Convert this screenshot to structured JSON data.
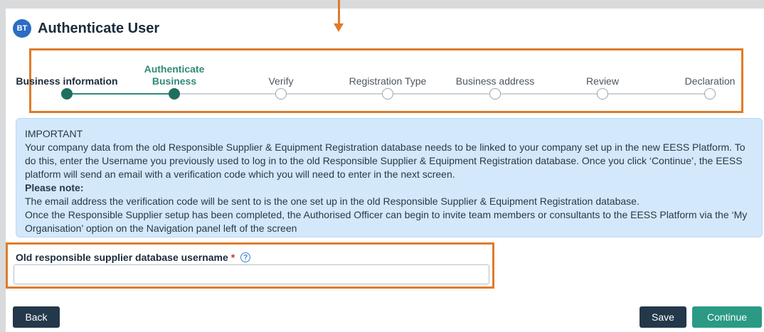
{
  "header": {
    "avatar_initials": "BT",
    "title": "Authenticate User"
  },
  "stepper": {
    "steps": [
      {
        "label": "Business information",
        "state": "done"
      },
      {
        "label": "Authenticate Business",
        "state": "current"
      },
      {
        "label": "Verify",
        "state": "pending"
      },
      {
        "label": "Registration Type",
        "state": "pending"
      },
      {
        "label": "Business address",
        "state": "pending"
      },
      {
        "label": "Review",
        "state": "pending"
      },
      {
        "label": "Declaration",
        "state": "pending"
      }
    ]
  },
  "notice": {
    "heading": "IMPORTANT",
    "paragraph": "Your company data from the old Responsible Supplier & Equipment Registration database needs to be linked to your company set up in the new EESS Platform. To do this, enter the Username you previously used to log in to the old Responsible Supplier & Equipment Registration database. Once you click ‘Continue’, the EESS platform will send an email with a verification code which you will need to enter in the next screen.",
    "note_heading": "Please note:",
    "note_line1": "The email address the verification code will be sent to is the one set up in the old Responsible Supplier & Equipment Registration database.",
    "note_line2": "Once the Responsible Supplier setup has been completed, the Authorised Officer can begin to invite team members or consultants to the EESS Platform via the ‘My Organisation’ option on the Navigation panel left of the screen"
  },
  "form": {
    "username_label": "Old responsible supplier database username",
    "required_mark": "*",
    "help_glyph": "?",
    "username_value": ""
  },
  "actions": {
    "back_label": "Back",
    "save_label": "Save",
    "continue_label": "Continue"
  },
  "colors": {
    "accent": "#2a9a85",
    "dark_button": "#24384b",
    "callout": "#e07b2a",
    "notice_bg": "#d3e8fb"
  }
}
